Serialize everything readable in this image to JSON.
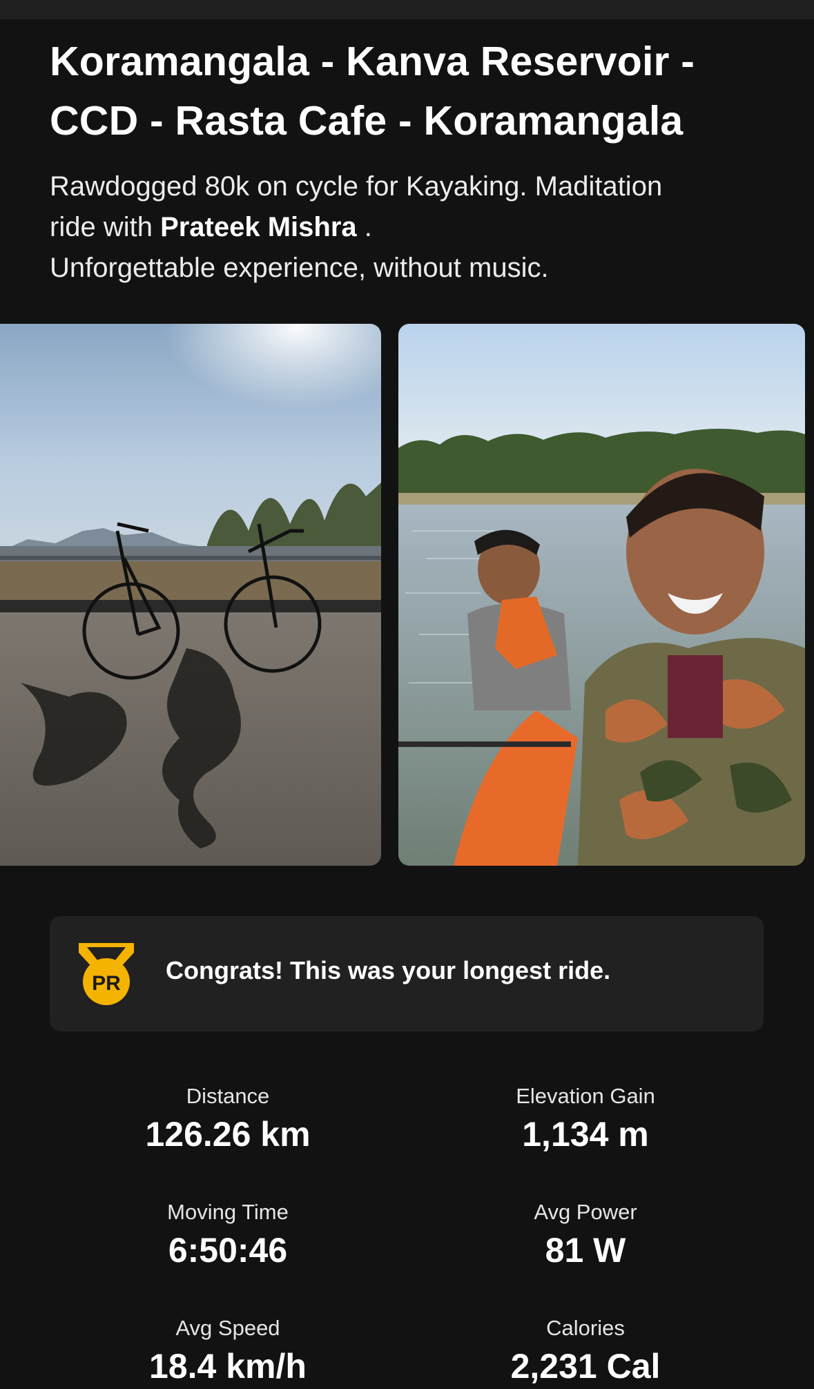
{
  "activity": {
    "title_line1": "Koramangala - Kanva Reservoir -",
    "title_line2": "CCD - Rasta Cafe - Koramangala",
    "desc_line1": "Rawdogged 80k on cycle for Kayaking. Maditation",
    "desc_line2_prefix": "ride with ",
    "mention": "Prateek Mishra",
    "desc_line2_suffix": " .",
    "desc_line3": "Unforgettable experience, without music."
  },
  "photos": [
    {
      "name": "bicycles-photo"
    },
    {
      "name": "kayaking-selfie-photo"
    }
  ],
  "achievement": {
    "badge_icon": "pr-medal-icon",
    "badge_text": "PR",
    "badge_color": "#F5B301",
    "message": "Congrats! This was your longest ride."
  },
  "stats": {
    "distance": {
      "label": "Distance",
      "value": "126.26 km"
    },
    "elevation": {
      "label": "Elevation Gain",
      "value": "1,134 m"
    },
    "moving_time": {
      "label": "Moving Time",
      "value": "6:50:46"
    },
    "avg_power": {
      "label": "Avg Power",
      "value": "81 W"
    },
    "avg_speed": {
      "label": "Avg Speed",
      "value": "18.4 km/h"
    },
    "calories": {
      "label": "Calories",
      "value": "2,231 Cal"
    }
  }
}
